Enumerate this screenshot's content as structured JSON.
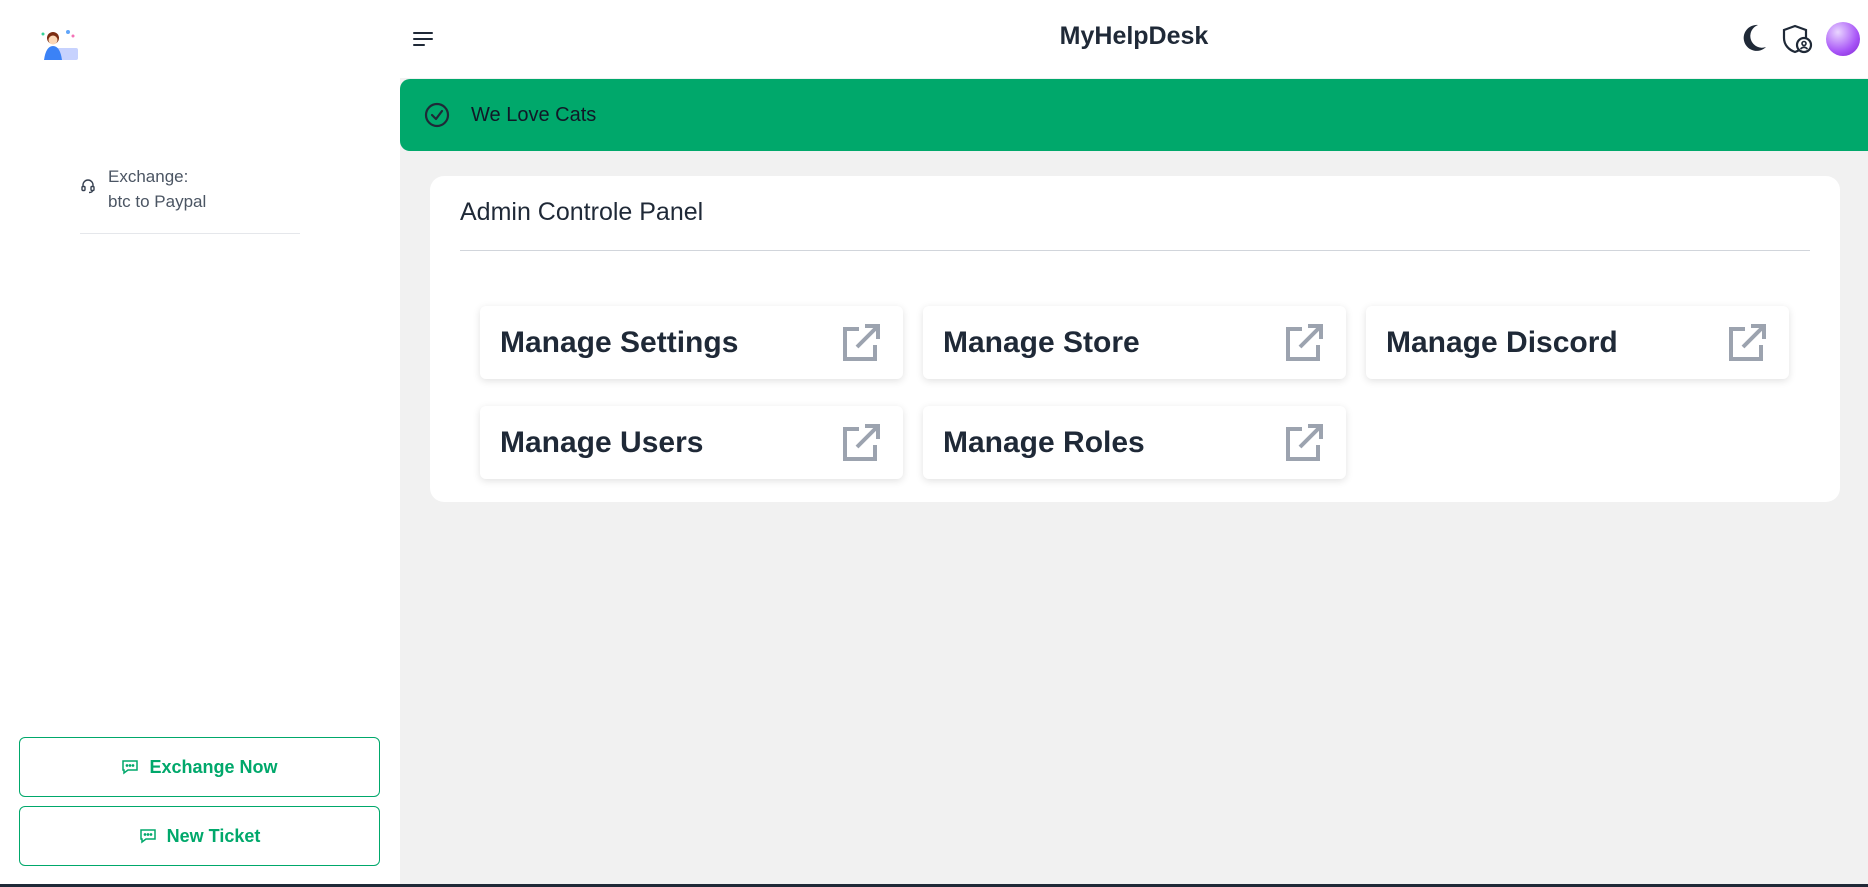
{
  "app": {
    "title": "MyHelpDesk"
  },
  "sidebar": {
    "nav_items": [
      {
        "label_line1": "Exchange:",
        "label_line2": "btc to Paypal",
        "icon": "headset-icon"
      }
    ],
    "buttons": {
      "exchange": {
        "label": "Exchange Now",
        "icon": "chat-icon"
      },
      "ticket": {
        "label": "New Ticket",
        "icon": "chat-icon"
      }
    }
  },
  "header": {
    "icons": [
      "menu-icon",
      "moon-icon",
      "shield-user-icon",
      "avatar"
    ]
  },
  "notice": {
    "text": "We Love Cats",
    "icon": "check-circle-icon",
    "color": "#00a86b"
  },
  "panel": {
    "title": "Admin Controle Panel",
    "cards": [
      {
        "label": "Manage Settings"
      },
      {
        "label": "Manage Store"
      },
      {
        "label": "Manage Discord"
      },
      {
        "label": "Manage Users"
      },
      {
        "label": "Manage Roles"
      }
    ]
  },
  "colors": {
    "accent": "#00a86b",
    "background": "#f1f1f1",
    "text": "#1f2937",
    "icon_muted": "#9ca3af"
  }
}
